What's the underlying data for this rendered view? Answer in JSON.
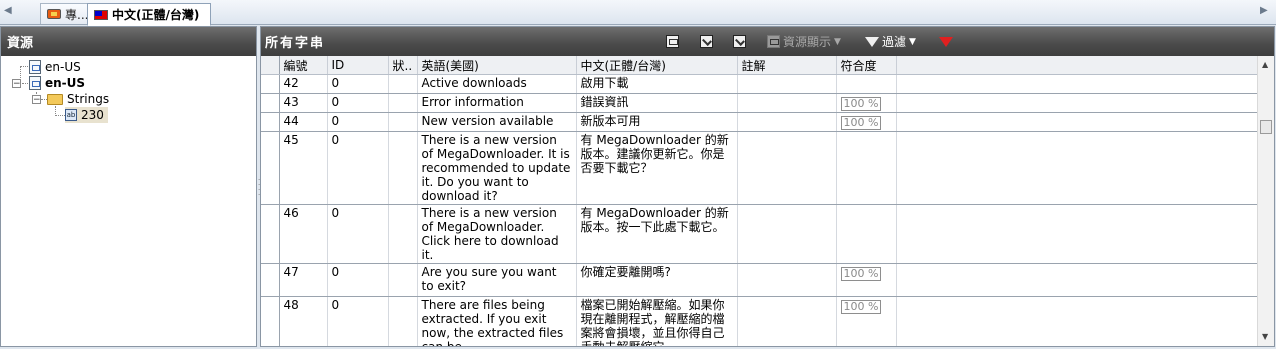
{
  "tabs": [
    {
      "label": "專...",
      "icon": "app-icon"
    },
    {
      "label": "中文(正體/台灣)",
      "icon": "taiwan-flag-icon",
      "active": true
    }
  ],
  "left_panel": {
    "title": "資源",
    "tree": [
      {
        "label": "en-US",
        "icon": "resource-file-icon"
      },
      {
        "label": "en-US",
        "icon": "resource-file-icon",
        "bold": true
      },
      {
        "label": "Strings",
        "icon": "folder-icon"
      },
      {
        "label": "230",
        "icon": "string-table-icon",
        "selected": true
      }
    ]
  },
  "right_panel": {
    "title": "所有字串",
    "toolbar": {
      "resource_display": "資源顯示",
      "filter": "過濾"
    },
    "columns": [
      "編號",
      "ID",
      "狀..",
      "英語(美國)",
      "中文(正體/台灣)",
      "註解",
      "符合度"
    ],
    "rows": [
      {
        "num": "42",
        "id": "0",
        "status": "",
        "en": "Active downloads",
        "zh": "啟用下載",
        "note": "",
        "match": ""
      },
      {
        "num": "43",
        "id": "0",
        "status": "",
        "en": "Error information",
        "zh": "錯誤資訊",
        "note": "",
        "match": "100 %"
      },
      {
        "num": "44",
        "id": "0",
        "status": "",
        "en": "New version available",
        "zh": "新版本可用",
        "note": "",
        "match": "100 %"
      },
      {
        "num": "45",
        "id": "0",
        "status": "",
        "en": "There is a new version of MegaDownloader. It is recommended to update it. Do you want to download it?",
        "zh": "有 MegaDownloader 的新版本。建議你更新它。你是否要下載它？",
        "note": "",
        "match": ""
      },
      {
        "num": "46",
        "id": "0",
        "status": "",
        "en": "There is a new version of MegaDownloader. Click here to download it.",
        "zh": "有 MegaDownloader 的新版本。按一下此處下載它。",
        "note": "",
        "match": ""
      },
      {
        "num": "47",
        "id": "0",
        "status": "",
        "en": "Are you sure you want to exit?",
        "zh": "你確定要離開嗎?",
        "note": "",
        "match": "100 %"
      },
      {
        "num": "48",
        "id": "0",
        "status": "",
        "en": "There are files being extracted. If you exit now, the extracted files can be",
        "zh": "檔案已開始解壓縮。如果你現在離開程式，解壓縮的檔案將會損壞，並且你得自己手動去解壓縮它。",
        "note": "",
        "match": "100 %"
      }
    ]
  }
}
